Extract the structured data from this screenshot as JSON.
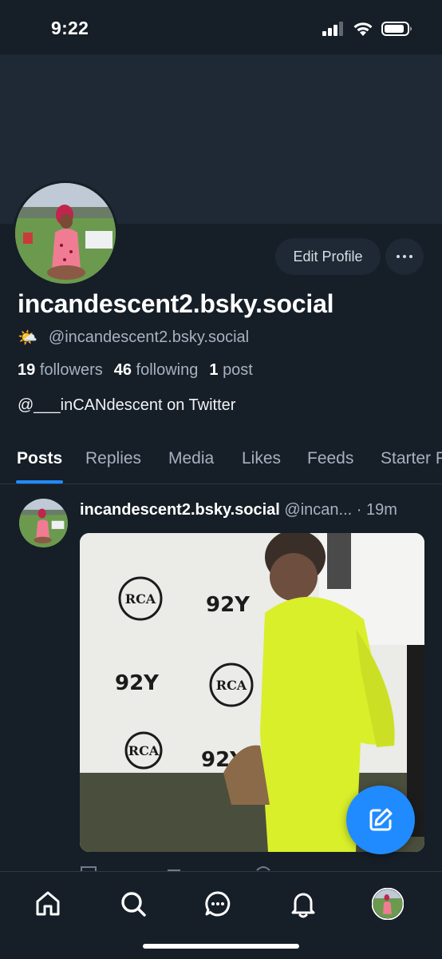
{
  "status_bar": {
    "time": "9:22"
  },
  "profile": {
    "display_name": "incandescent2.bsky.social",
    "emoji": "🌤️",
    "handle": "@incandescent2.bsky.social",
    "followers_count": "19",
    "followers_label": "followers",
    "following_count": "46",
    "following_label": "following",
    "posts_count": "1",
    "posts_label": "post",
    "bio": "@___inCANdescent on Twitter",
    "edit_profile_label": "Edit Profile"
  },
  "tabs": [
    {
      "label": "Posts",
      "active": true
    },
    {
      "label": "Replies"
    },
    {
      "label": "Media"
    },
    {
      "label": "Likes"
    },
    {
      "label": "Feeds"
    },
    {
      "label": "Starter Packs"
    }
  ],
  "post": {
    "author": "incandescent2.bsky.social",
    "handle": "@incan...",
    "time": "· 19m",
    "media_texts": {
      "logo_a": "RCA",
      "logo_b": "92Y"
    }
  },
  "icons": {
    "home": "home-icon",
    "search": "search-icon",
    "chat": "chat-icon",
    "bell": "bell-icon",
    "avatar": "profile-avatar",
    "compose": "compose-icon"
  },
  "colors": {
    "accent": "#208bfe",
    "background": "#161e27",
    "banner": "#1e2935"
  }
}
